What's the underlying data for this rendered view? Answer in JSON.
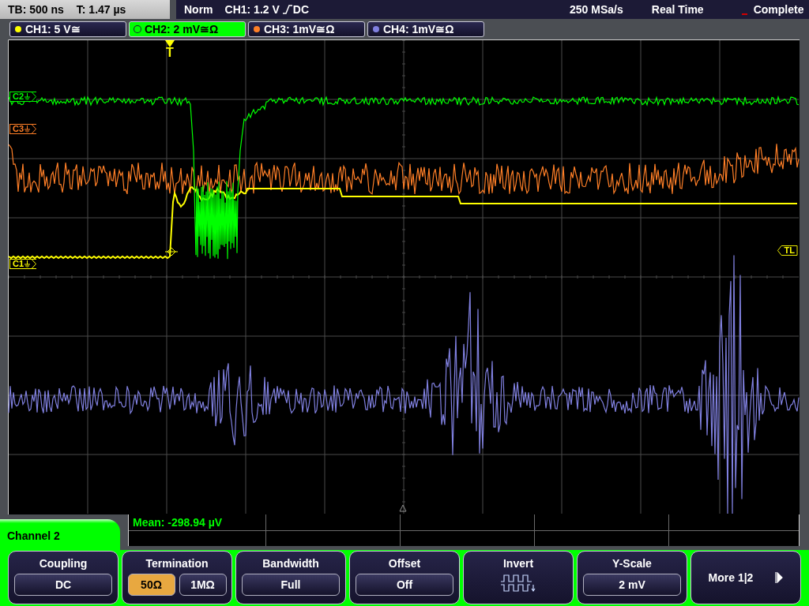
{
  "timebase": {
    "scale": "TB: 500 ns",
    "trigger_time": "T: 1.47 µs"
  },
  "status_bar": {
    "trigger_mode": "Norm",
    "trigger_level": "CH1: 1.2 V",
    "trigger_coupling": "DC",
    "sample_rate": "250 MSa/s",
    "acquisition_mode": "Real Time",
    "acquisition_state": "Complete"
  },
  "channel_tabs": [
    {
      "label": "CH1: 5 V≅",
      "color": "#ffff00",
      "selected": false
    },
    {
      "label": "CH2: 2 mV≅Ω",
      "color": "#00ff00",
      "selected": true
    },
    {
      "label": "CH3: 1mV≅Ω",
      "color": "#ff7f27",
      "selected": false
    },
    {
      "label": "CH4: 1mV≅Ω",
      "color": "#8080e0",
      "selected": false
    }
  ],
  "plot": {
    "trigger_marker": "T",
    "trigger_level_marker": "TL",
    "channel_markers": [
      {
        "label": "C2",
        "color": "#00ff00"
      },
      {
        "label": "C3",
        "color": "#ff7f27"
      },
      {
        "label": "C1",
        "color": "#ffff00"
      }
    ]
  },
  "menu": {
    "title": "Channel 2",
    "measurement": "Mean: -298.94 µV",
    "softkeys": [
      {
        "kind": "value",
        "label": "Coupling",
        "value": "DC"
      },
      {
        "kind": "options",
        "label": "Termination",
        "options": [
          {
            "label": "50Ω",
            "selected": true
          },
          {
            "label": "1MΩ",
            "selected": false
          }
        ]
      },
      {
        "kind": "value",
        "label": "Bandwidth",
        "value": "Full"
      },
      {
        "kind": "value",
        "label": "Offset",
        "value": "Off"
      },
      {
        "kind": "icon",
        "label": "Invert"
      },
      {
        "kind": "value",
        "label": "Y-Scale",
        "value": "2 mV"
      },
      {
        "kind": "more",
        "label": "More 1|2"
      }
    ]
  }
}
